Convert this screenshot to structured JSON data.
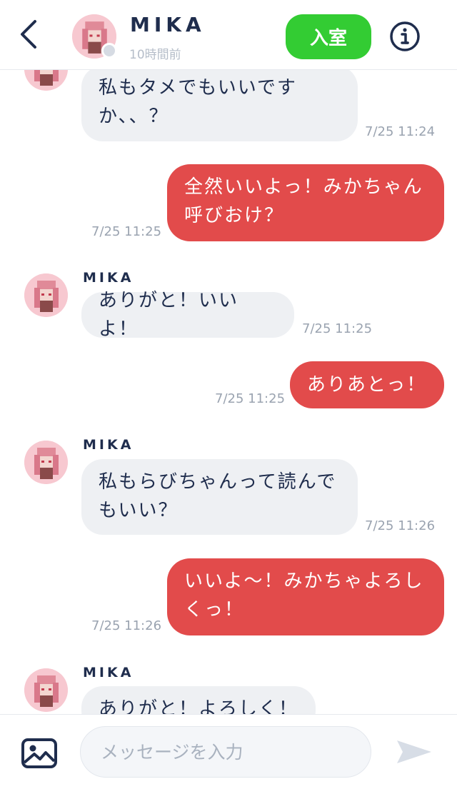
{
  "header": {
    "contact_name": "MIKA",
    "last_seen": "10時間前",
    "enter_label": "入室",
    "icons": {
      "back": "chevron-left-icon",
      "info": "info-icon",
      "avatar": "pixel-girl-avatar"
    }
  },
  "colors": {
    "outgoing_bubble": "#e24b4b",
    "incoming_bubble": "#eef0f3",
    "enter_button": "#33cc33",
    "text_dark": "#1f2d4d",
    "timestamp": "#9aa3b0"
  },
  "messages": [
    {
      "direction": "in",
      "text_line1": "私もタメでもいいです",
      "text_line2": "か、、？",
      "time": "7/25 11:24"
    },
    {
      "direction": "out",
      "text_line1": "全然いいよっ！みかちゃん",
      "text_line2": "呼びおけ？",
      "time": "7/25 11:25"
    },
    {
      "direction": "in",
      "sender": "MIKA",
      "text": "ありがと！いいよ！",
      "time": "7/25 11:25"
    },
    {
      "direction": "out",
      "text": "ありあとっ！",
      "time": "7/25 11:25"
    },
    {
      "direction": "in",
      "sender": "MIKA",
      "text_line1": "私もらびちゃんって読んで",
      "text_line2": "もいい？",
      "time": "7/25 11:26"
    },
    {
      "direction": "out",
      "text_line1": "いいよ〜！みかちゃよろし",
      "text_line2": "くっ！",
      "time": "7/25 11:26"
    },
    {
      "direction": "in",
      "sender": "MIKA",
      "text": "ありがと！よろしく！"
    }
  ],
  "composer": {
    "placeholder": "メッセージを入力",
    "icons": {
      "image": "image-icon",
      "send": "send-icon"
    }
  }
}
